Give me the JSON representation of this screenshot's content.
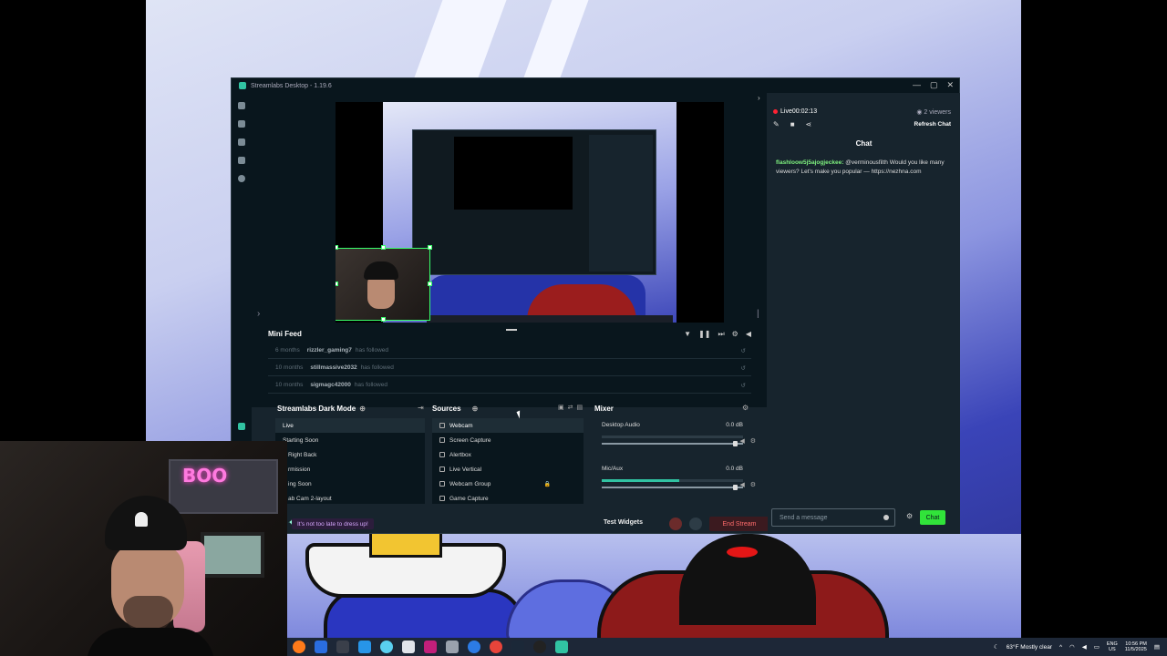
{
  "window": {
    "title": "Streamlabs Desktop - 1.19.6",
    "controls": [
      "—",
      "▢",
      "✕"
    ]
  },
  "minifeed": {
    "title": "Mini Feed",
    "rows": [
      {
        "time": "6 months",
        "user": "rizzler_gaming7",
        "action": "has followed"
      },
      {
        "time": "10 months",
        "user": "stillmassive2032",
        "action": "has followed"
      },
      {
        "time": "10 months",
        "user": "sigmagc42000",
        "action": "has followed"
      }
    ]
  },
  "scenes": {
    "title": "Streamlabs Dark Mode",
    "items": [
      "Live",
      "Starting Soon",
      "Right Back",
      "rmission",
      "ing Soon",
      "ab Cam 2-layout"
    ]
  },
  "sources": {
    "title": "Sources",
    "items": [
      "Webcam",
      "Screen Capture",
      "Alertbox",
      "Live Vertical",
      "Webcam Group",
      "Game Capture"
    ]
  },
  "mixer": {
    "title": "Mixer",
    "channels": [
      {
        "name": "Desktop Audio",
        "level": "0.0 dB",
        "meter": 0,
        "volume": 0.96
      },
      {
        "name": "Mic/Aux",
        "level": "0.0 dB",
        "meter": 0.55,
        "volume": 0.96
      }
    ]
  },
  "footer": {
    "tip": "It's not too late to dress up!",
    "test_widgets": "Test Widgets",
    "end_stream": "End Stream"
  },
  "chat": {
    "live_time": "Live00:02:13",
    "viewers": "2 viewers",
    "refresh": "Refresh Chat",
    "title": "Chat",
    "message_author": "flashloow5j5ajogjeckee:",
    "message_text": " @verminousfilth Would you like many viewers? Let's make you popular — https://nezhna.com",
    "input_placeholder": "Send a message",
    "send_label": "Chat"
  },
  "webcam": {
    "neon_sign": "BOO"
  },
  "taskbar": {
    "weather": "63°F Mostly clear",
    "lang_top": "ENG",
    "lang_bottom": "US",
    "time": "10:56 PM",
    "date": "11/5/2025"
  },
  "colors": {
    "accent": "#31c3a2",
    "live_red": "#ff2233",
    "chat_button": "#31e33a",
    "panel_bg": "#17242d",
    "dark_bg": "#09161d"
  }
}
